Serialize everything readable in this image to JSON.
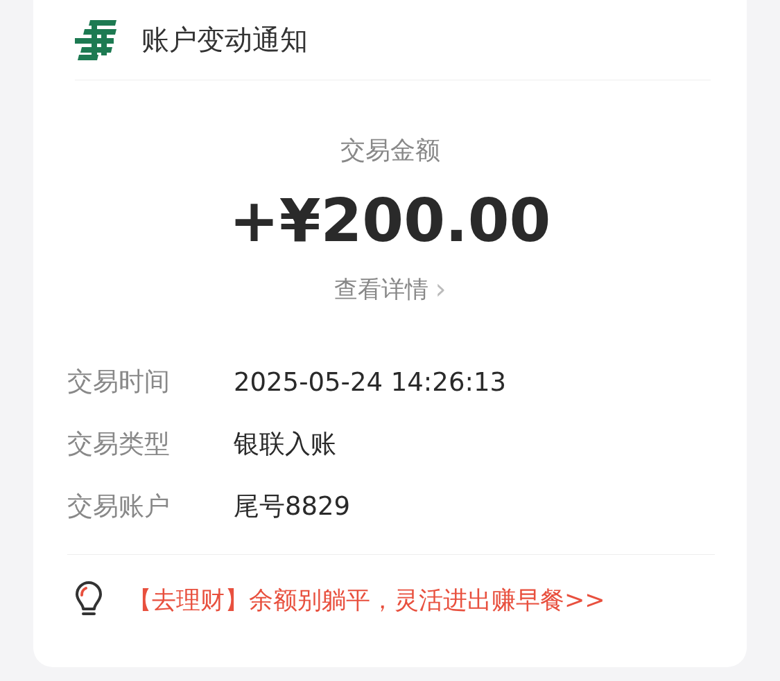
{
  "header": {
    "title": "账户变动通知"
  },
  "amount": {
    "label": "交易金额",
    "value": "+¥200.00",
    "link": "查看详情",
    "link_arrow": "›"
  },
  "details": [
    {
      "label": "交易时间",
      "value": "2025-05-24 14:26:13"
    },
    {
      "label": "交易类型",
      "value": "银联入账"
    },
    {
      "label": "交易账户",
      "value": "尾号8829"
    }
  ],
  "promo": {
    "text": "【去理财】余额别躺平，灵活进出赚早餐>>"
  }
}
